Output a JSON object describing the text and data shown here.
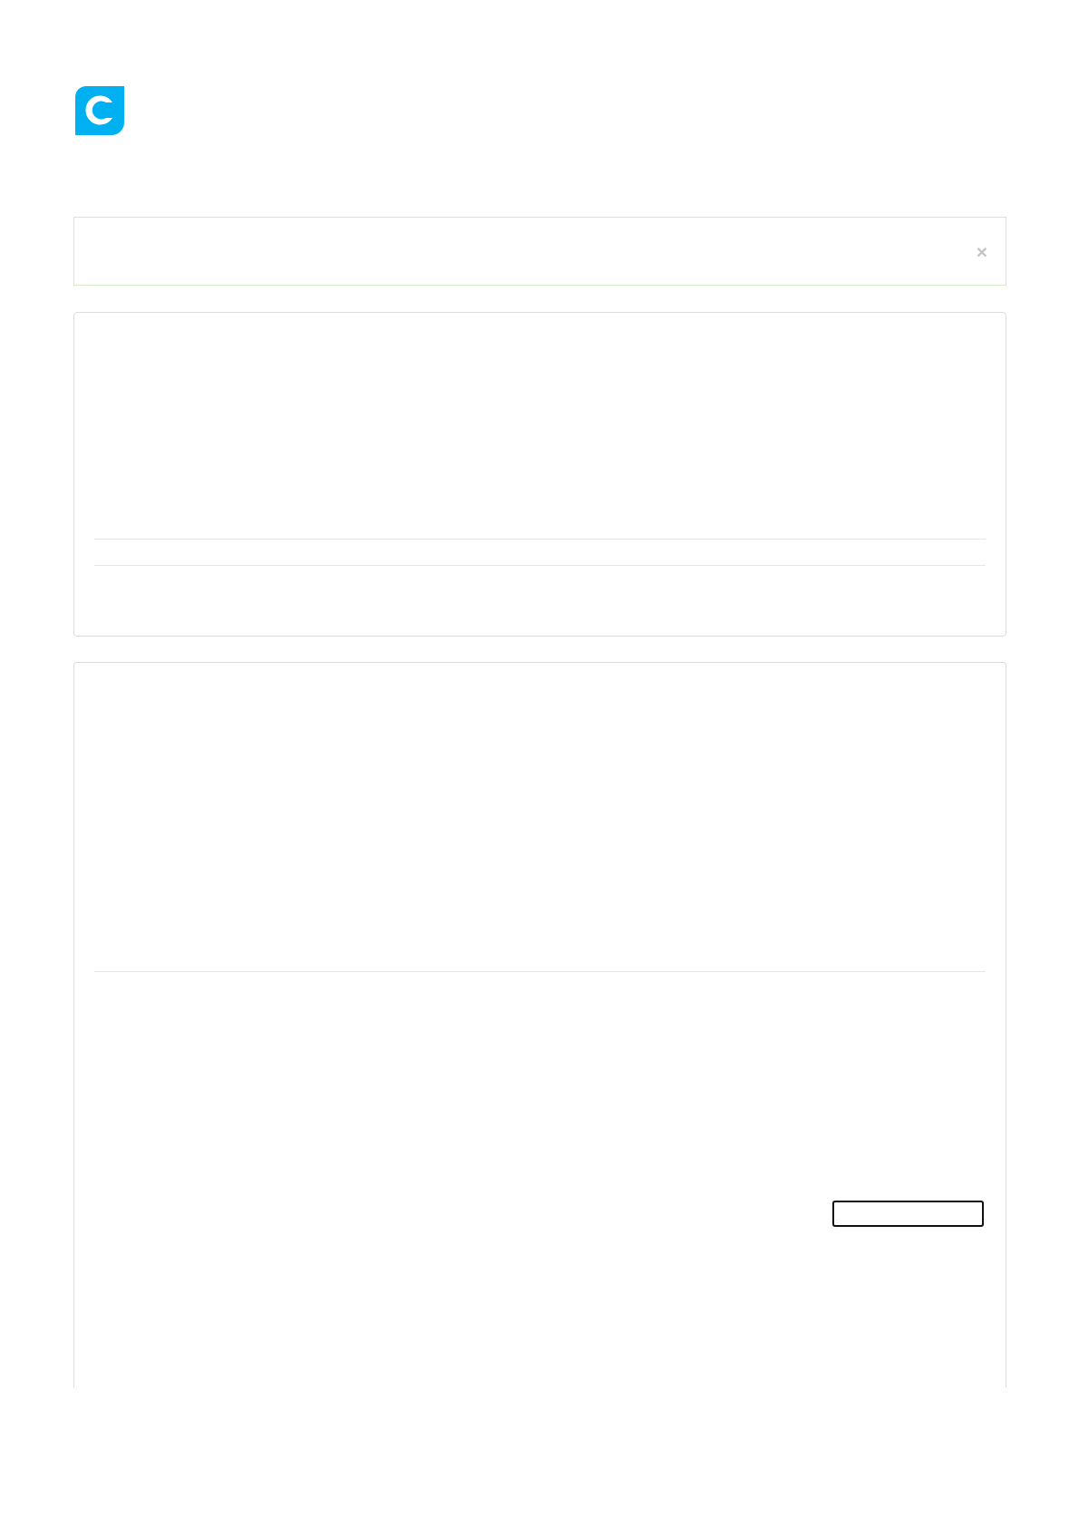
{
  "alert": {
    "close_label": "×"
  }
}
